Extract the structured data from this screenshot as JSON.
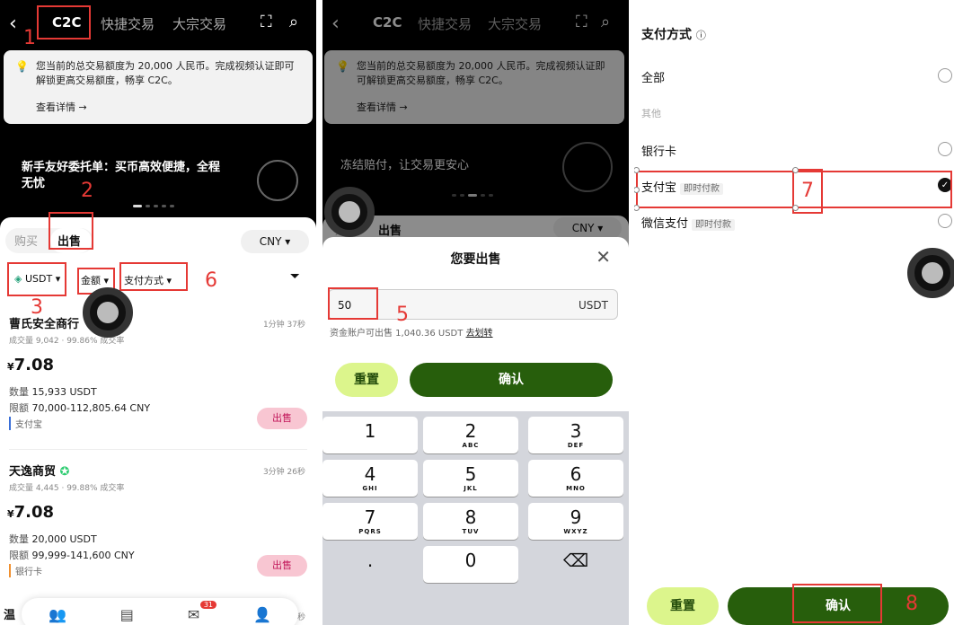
{
  "p1": {
    "tabs": [
      "C2C",
      "快捷交易",
      "大宗交易"
    ],
    "notice": "您当前的总交易额度为 20,000 人民币。完成视频认证即可解锁更高交易额度，畅享 C2C。",
    "notice_more": "查看详情 →",
    "banner": "新手友好委托单：买币高效便捷，全程无忧",
    "mode_buy": "购买",
    "mode_sell": "出售",
    "currency": "CNY ▾",
    "filters": {
      "coin": "USDT ▾",
      "amount": "金额 ▾",
      "payment": "支付方式 ▾"
    },
    "merchants": [
      {
        "name": "曹氏安全商行",
        "stats": "成交量 9,042 · 99.86% 成交率",
        "time": "1分钟 37秒",
        "price_symbol": "¥",
        "price": "7.08",
        "qty_label": "数量",
        "qty": "15,933 USDT",
        "limit_label": "限额",
        "limit": "70,000-112,805.64 CNY",
        "pay": "支付宝",
        "btn": "出售"
      },
      {
        "name": "天逸商贸",
        "stats": "成交量 4,445 · 99.88% 成交率",
        "time": "3分钟 26秒",
        "price_symbol": "¥",
        "price": "7.08",
        "qty_label": "数量",
        "qty": "20,000 USDT",
        "limit_label": "限额",
        "limit": "99,999-141,600 CNY",
        "pay": "银行卡",
        "btn": "出售"
      }
    ],
    "bottom_partial": "温",
    "bottom_time": "秒",
    "nav_badge": "31"
  },
  "p2": {
    "tabs": [
      "C2C",
      "快捷交易",
      "大宗交易"
    ],
    "notice": "您当前的总交易额度为 20,000 人民币。完成视频认证即可解锁更高交易额度，畅享 C2C。",
    "notice_more": "查看详情 →",
    "banner": "冻结赔付，让交易更安心",
    "mode_buy": "购买",
    "mode_sell": "出售",
    "currency": "CNY ▾",
    "modal_title": "您要出售",
    "amount_value": "50",
    "amount_unit": "USDT",
    "available": "资金账户可出售 1,040.36 USDT",
    "transfer": "去划转",
    "reset": "重置",
    "confirm": "确认",
    "keys": [
      {
        "n": "1",
        "l": ""
      },
      {
        "n": "2",
        "l": "ABC"
      },
      {
        "n": "3",
        "l": "DEF"
      },
      {
        "n": "4",
        "l": "GHI"
      },
      {
        "n": "5",
        "l": "JKL"
      },
      {
        "n": "6",
        "l": "MNO"
      },
      {
        "n": "7",
        "l": "PQRS"
      },
      {
        "n": "8",
        "l": "TUV"
      },
      {
        "n": "9",
        "l": "WXYZ"
      },
      {
        "n": ".",
        "l": ""
      },
      {
        "n": "0",
        "l": ""
      },
      {
        "n": "⌫",
        "l": ""
      }
    ]
  },
  "p3": {
    "title": "支付方式",
    "all": "全部",
    "other": "其他",
    "bank": "银行卡",
    "alipay": "支付宝",
    "alipay_tag": "即时付款",
    "wechat": "微信支付",
    "wechat_tag": "即时付款",
    "reset": "重置",
    "confirm": "确认"
  },
  "annotations": [
    "1",
    "2",
    "3",
    "4",
    "5",
    "6",
    "7",
    "8"
  ],
  "colors": {
    "accent_green": "#275e0c",
    "light_green": "#dcf58c",
    "annotation_red": "#e53935",
    "sell_pink": "#f8c6d2"
  }
}
